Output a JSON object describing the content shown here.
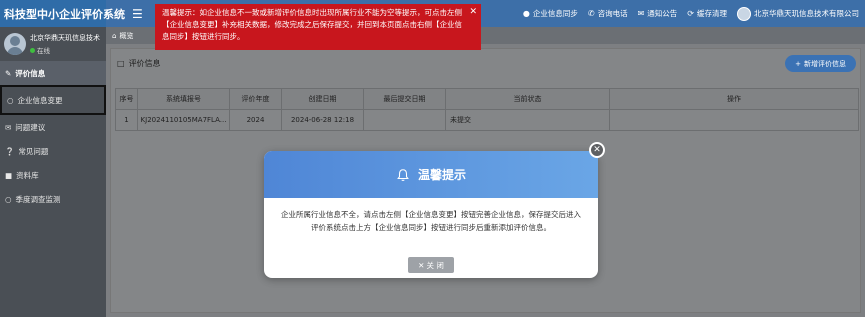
{
  "app": {
    "title": "科技型中小企业评价系统"
  },
  "header": {
    "items": [
      {
        "icon": "user-icon",
        "label": "企业信息同步"
      },
      {
        "icon": "phone-icon",
        "label": "咨询电话"
      },
      {
        "icon": "notice-icon",
        "label": "通知公告"
      },
      {
        "icon": "cache-icon",
        "label": "缓存清理"
      },
      {
        "icon": "avatar-icon",
        "label": "北京华鼎天玑信息技术有限公司"
      }
    ]
  },
  "sidebar": {
    "user_name": "北京华鼎天玑信息技术",
    "user_status": "在线",
    "items": [
      {
        "icon": "edit-icon",
        "label": "评价信息",
        "active": true
      },
      {
        "icon": "circle-icon",
        "label": "企业信息变更"
      },
      {
        "icon": "chat-icon",
        "label": "问题建议"
      },
      {
        "icon": "question-icon",
        "label": "常见问题"
      },
      {
        "icon": "folder-icon",
        "label": "资料库"
      },
      {
        "icon": "circle-icon",
        "label": "季度调查监测"
      }
    ]
  },
  "tabs": {
    "home": "概览"
  },
  "panel": {
    "title": "评价信息",
    "add_button": "新增评价信息"
  },
  "table": {
    "columns": [
      "序号",
      "系统填报号",
      "评价年度",
      "创建日期",
      "最后提交日期",
      "当前状态",
      "操作"
    ],
    "rows": [
      [
        "1",
        "KJ2024110105MA7FLA...",
        "2024",
        "2024-06-28 12:18",
        "",
        "未提交",
        ""
      ]
    ]
  },
  "warning": {
    "text": "温馨提示：如企业信息不一致或新增评价信息时出现所属行业不能为空等提示，可点击左侧【企业信息变更】补充相关数据，修改完成之后保存提交，并回到本页面点击右侧【企业信息同步】按钮进行同步。"
  },
  "modal": {
    "title": "温馨提示",
    "body": "企业所属行业信息不全，请点击左侧【企业信息变更】按钮完善企业信息，保存提交后进入评价系统点击上方【企业信息同步】按钮进行同步后重新添加评价信息。",
    "close_button": "关 闭"
  }
}
